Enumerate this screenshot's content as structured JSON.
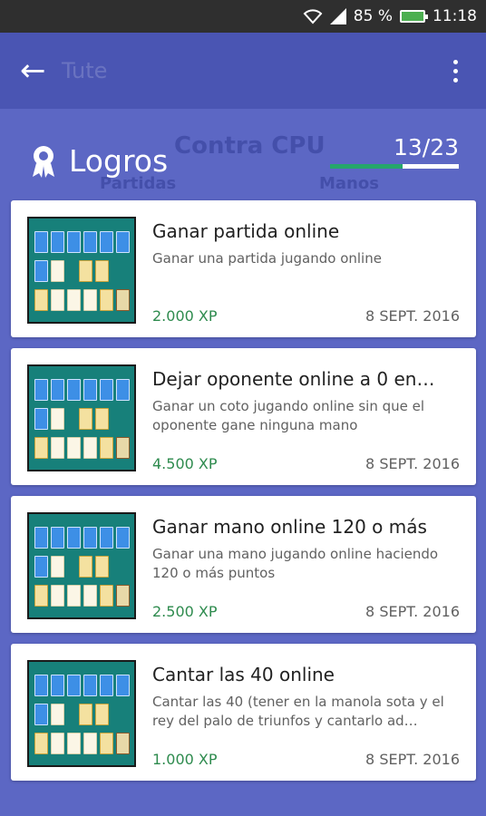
{
  "status_bar": {
    "battery_percent": "85 %",
    "time": "11:18",
    "wifi_icon": "wifi-icon",
    "signal_icon": "signal-icon",
    "battery_icon": "battery-charging-icon"
  },
  "toolbar": {
    "back_icon": "arrow-back-icon",
    "ghost_title": "Tute",
    "menu_icon": "more-vert-icon"
  },
  "header": {
    "title": "Logros",
    "icon": "award-ribbon-icon",
    "progress_text": "13/23",
    "progress_value": 0.565,
    "ghost_cpu": "Contra CPU",
    "ghost_partidas": "Partidas",
    "ghost_manos": "Manos",
    "colors": {
      "accent": "#26a66b",
      "primary": "#4a55b3",
      "background": "#5c67c4"
    }
  },
  "achievements": [
    {
      "title": "Ganar partida online",
      "description": "Ganar una partida jugando online",
      "xp": "2.000 XP",
      "date": "8 SEPT. 2016"
    },
    {
      "title": "Dejar oponente online a 0 en…",
      "description": "Ganar un coto jugando online sin que el oponente gane ninguna mano",
      "xp": "4.500 XP",
      "date": "8 SEPT. 2016"
    },
    {
      "title": "Ganar mano online 120 o más",
      "description": "Ganar una mano jugando online haciendo 120 o más puntos",
      "xp": "2.500 XP",
      "date": "8 SEPT. 2016"
    },
    {
      "title": "Cantar las 40 online",
      "description": "Cantar las 40 (tener en la manola sota y el rey del palo de triunfos y cantarlo ad…",
      "xp": "1.000 XP",
      "date": "8 SEPT. 2016"
    }
  ]
}
